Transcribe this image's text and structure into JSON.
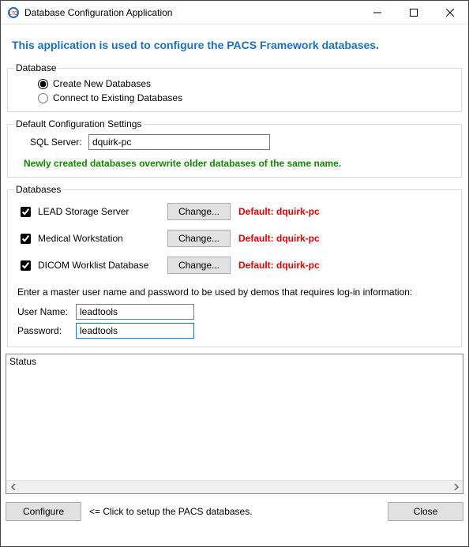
{
  "window": {
    "title": "Database Configuration Application"
  },
  "heading": "This application is used to configure the PACS Framework databases.",
  "groups": {
    "database_legend": "Database",
    "config_legend": "Default Configuration Settings",
    "databases_legend": "Databases"
  },
  "radios": {
    "create_label": "Create New Databases",
    "connect_label": "Connect to Existing Databases",
    "selected": "create"
  },
  "sql": {
    "label": "SQL Server:",
    "value": "dquirk-pc"
  },
  "warning_green": "Newly created databases overwrite older databases of the same name.",
  "db_items": [
    {
      "name": "LEAD Storage Server",
      "checked": true,
      "change": "Change...",
      "default_label": "Default: dquirk-pc"
    },
    {
      "name": "Medical Workstation",
      "checked": true,
      "change": "Change...",
      "default_label": "Default: dquirk-pc"
    },
    {
      "name": "DICOM Worklist Database",
      "checked": true,
      "change": "Change...",
      "default_label": "Default: dquirk-pc"
    }
  ],
  "master_instruction": "Enter a master user name and password to be used by demos that requires log-in information:",
  "user": {
    "label": "User Name:",
    "value": "leadtools"
  },
  "pass": {
    "label": "Password:",
    "value": "leadtools"
  },
  "status": {
    "label": "Status"
  },
  "buttons": {
    "configure": "Configure",
    "configure_hint": "<= Click to setup the PACS databases.",
    "close": "Close"
  }
}
